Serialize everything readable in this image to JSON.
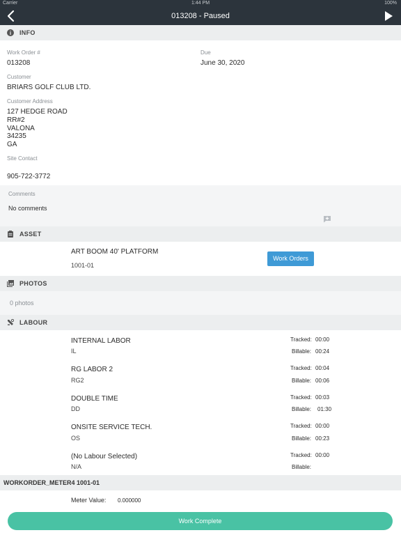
{
  "status_bar": {
    "carrier": "Carrier",
    "time": "1:44 PM",
    "battery": "100%"
  },
  "navbar": {
    "title": "013208 - Paused"
  },
  "info": {
    "header": "INFO",
    "work_order_label": "Work Order #",
    "work_order_value": "013208",
    "due_label": "Due",
    "due_value": "June 30, 2020",
    "customer_label": "Customer",
    "customer_value": "BRIARS GOLF CLUB LTD.",
    "address_label": "Customer Address",
    "address_lines": [
      "127 HEDGE ROAD",
      "RR#2",
      "VALONA",
      "34235",
      "GA"
    ],
    "site_contact_label": "Site Contact",
    "site_contact_value": "905-722-3772",
    "comments_label": "Comments",
    "comments_value": "No comments"
  },
  "asset": {
    "header": "ASSET",
    "name": "ART BOOM 40' PLATFORM",
    "code": "1001-01",
    "work_orders_button": "Work Orders"
  },
  "photos": {
    "header": "PHOTOS",
    "count_text": "0 photos"
  },
  "labour": {
    "header": "LABOUR",
    "tracked_label": "Tracked:",
    "billable_label": "Billable:",
    "items": [
      {
        "name": "INTERNAL LABOR",
        "code": "IL",
        "tracked": "00:00",
        "billable": "00:24"
      },
      {
        "name": "RG LABOR 2",
        "code": "RG2",
        "tracked": "00:04",
        "billable": "00:06"
      },
      {
        "name": "DOUBLE TIME",
        "code": "DD",
        "tracked": "00:03",
        "billable": "01:30"
      },
      {
        "name": "ONSITE SERVICE TECH.",
        "code": "OS",
        "tracked": "00:00",
        "billable": "00:23"
      },
      {
        "name": "(No Labour Selected)",
        "code": "N/A",
        "tracked": "00:00",
        "billable": ""
      }
    ]
  },
  "meter": {
    "header": "WORKORDER_METER4 1001-01",
    "value_label": "Meter Value:",
    "value": "0.000000"
  },
  "footer": {
    "work_complete_button": "Work Complete"
  },
  "colors": {
    "navbar": "#2c343c",
    "accent_blue": "#3f9ad6",
    "complete_green": "#49c2a4",
    "section_bg": "#eceeef"
  }
}
